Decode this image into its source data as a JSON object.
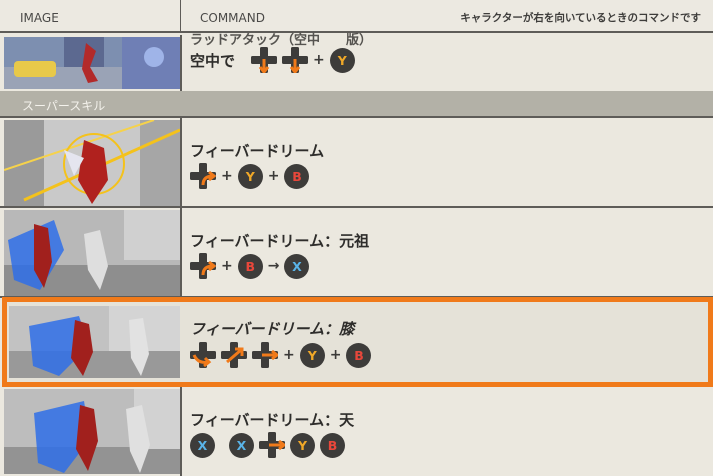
{
  "header": {
    "col_image": "IMAGE",
    "col_command": "COMMAND",
    "note": "キャラクターが右を向いているときのコマンドです"
  },
  "rows": [
    {
      "name_partial": "ラッドアタック（空中　　版）",
      "name": "空中で",
      "commands": [
        "dpad-down",
        "dpad-down",
        "+",
        "Y"
      ]
    }
  ],
  "category": "スーパースキル",
  "skills": [
    {
      "name": "フィーバードリーム",
      "commands": [
        "dpad-right-turn",
        "+",
        "Y",
        "+",
        "B"
      ]
    },
    {
      "name": "フィーバードリーム：元祖",
      "commands": [
        "dpad-right-turn",
        "+",
        "B",
        "→",
        "X"
      ]
    },
    {
      "name": "フィーバードリーム：膝",
      "selected": true,
      "commands": [
        "dpad-left-turn",
        "dpad-down-right",
        "dpad-right",
        "+",
        "Y",
        "+",
        "B"
      ]
    },
    {
      "name": "フィーバードリーム：天",
      "commands": [
        "X",
        "X",
        "dpad-right",
        "Y",
        "B"
      ]
    }
  ],
  "colors": {
    "accent": "#f07a1a",
    "button_bg": "#3d3c3a",
    "Y": "#f0a828",
    "B": "#e8473b",
    "X": "#5ab4e8"
  }
}
